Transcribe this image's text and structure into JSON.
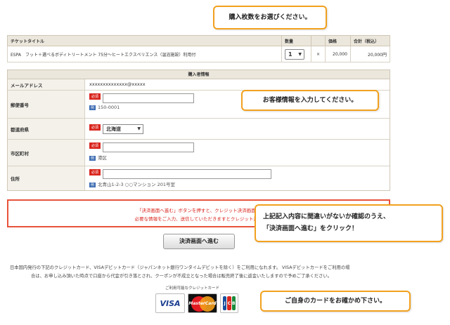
{
  "ticket": {
    "headers": [
      "チケットタイトル",
      "数量",
      "",
      "価格",
      "合計（税込）"
    ],
    "title": "ESPA　フット＋選べるボディトリートメント 75分～ヒートエクスペリエンス（温浴施設）利用付",
    "quantity": "1",
    "times": "×",
    "price": "20,000",
    "total": "20,000円"
  },
  "buyer": {
    "heading": "購入者情報",
    "required": "必須",
    "example_badge": "例",
    "email_label": "メールアドレス",
    "email_value": "xxxxxxxxxxxxxx@xxxxx",
    "postal_label": "郵便番号",
    "postal_example": "150-0001",
    "pref_label": "都道府県",
    "pref_value": "北海道",
    "city_label": "市区町村",
    "city_example": "港区",
    "address_label": "住所",
    "address_example": "北青山1-2-3 ○○マンション 201号室"
  },
  "notice": {
    "line1": "「決済画面へ進む」ボタンを押すと、クレジット決済画面へ",
    "line2": "必要な情報をご入力、送信していただきますとクレジット決済"
  },
  "submit_label": "決済画面へ進む",
  "footer": {
    "line1": "日本国内発行の下記のクレジットカード、VISAデビットカード（ジャパンネット銀行ワンタイムデビットを除く）をご利用になれます。 VISAデビットカードをご利用の場",
    "line2": "合は、お申し込み頂いた時点で口座から代金が引き落とされ、クーポンが不成立となった場合は販売終了後に返金いたしますので予めご了承ください。",
    "cards_label": "ご利用可能なクレジットカード",
    "visa": "VISA",
    "mastercard": "MasterCard",
    "jcb": [
      "J",
      "C",
      "B"
    ]
  },
  "callouts": {
    "quantity": "購入枚数をお選びください。",
    "info": "お客様情報を入力してください。",
    "confirm_line1": "上記記入内容に間違いがないか確認のうえ、",
    "confirm_line2": "「決済画面へ進む」をクリック！",
    "card": "ご自身のカードをお確かめ下さい。"
  },
  "colors": {
    "accent": "#f2a11e",
    "required": "#d9251d",
    "notice_border": "#e8533a"
  }
}
